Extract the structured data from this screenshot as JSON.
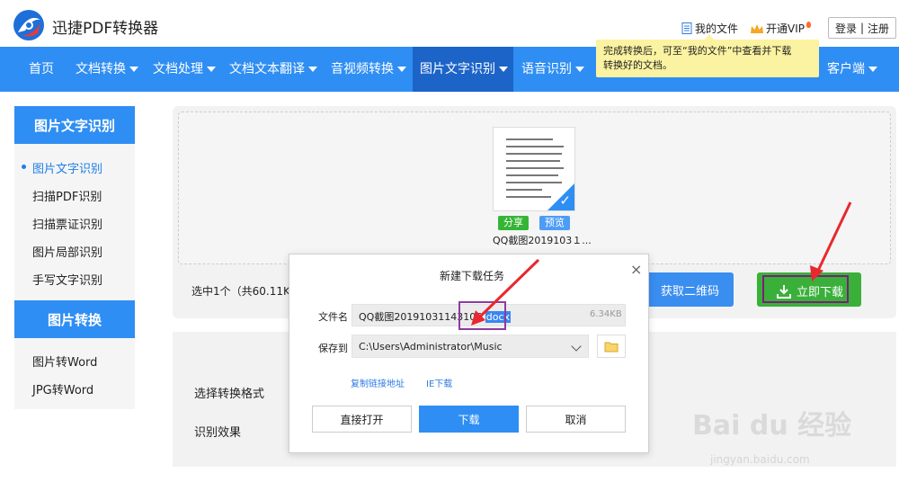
{
  "header": {
    "app_title": "迅捷PDF转换器",
    "my_files": "我的文件",
    "vip": "开通VIP",
    "login": "登录",
    "register": "注册",
    "separator": "|",
    "tooltip_line1": "完成转换后，可至“我的文件”中查看并下载",
    "tooltip_line2": "转换好的文档。"
  },
  "nav": {
    "items": [
      "首页",
      "文档转换",
      "文档处理",
      "文档文本翻译",
      "音视频转换",
      "图片文字识别",
      "语音识别",
      "客户端"
    ]
  },
  "sidebar": {
    "section1_title": "图片文字识别",
    "section1_items": [
      "图片文字识别",
      "扫描PDF识别",
      "扫描票证识别",
      "图片局部识别",
      "手写文字识别"
    ],
    "section2_title": "图片转换",
    "section2_items": [
      "图片转Word",
      "JPG转Word"
    ]
  },
  "workspace": {
    "share_label": "分享",
    "preview_label": "预览",
    "thumb_name": "QQ截图2019103１...",
    "selected_info": "选中1个（共60.11K）",
    "qr_label": "获取二维码",
    "download_label": "立即下载",
    "format_label": "选择转换格式",
    "effect_label": "识别效果"
  },
  "dialog": {
    "title": "新建下载任务",
    "filename_label": "文件名",
    "filename_base": "QQ截图20191031143106.",
    "filename_ext": "docx",
    "filesize": "6.34KB",
    "saveto_label": "保存到",
    "saveto_path": "C:\\Users\\Administrator\\Music",
    "copy_link": "复制链接地址",
    "ie_download": "IE下载",
    "open_label": "直接打开",
    "download_label": "下载",
    "cancel_label": "取消"
  },
  "watermark": {
    "brand": "Bai du 经验",
    "url": "jingyan.baidu.com"
  },
  "colors": {
    "nav_blue": "#2f8ef3",
    "nav_active": "#1c64c8",
    "download_green": "#3ab03a",
    "annotation_red": "#e8282e",
    "frame_purple": "#8e3aa0"
  }
}
